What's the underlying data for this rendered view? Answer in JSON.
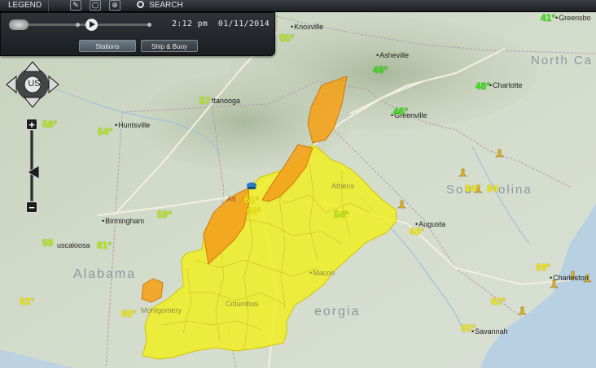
{
  "toolbar": {
    "legend_label": "LEGEND",
    "search_label": "SEARCH"
  },
  "time_panel": {
    "time": "2:12 pm",
    "date": "01/11/2014",
    "tabs": [
      {
        "label": "Stations",
        "active": true
      },
      {
        "label": "Ship & Buoy",
        "active": false
      }
    ]
  },
  "navigation": {
    "region_label": "US",
    "zoom_in": "+",
    "zoom_out": "−"
  },
  "states": [
    "North Ca",
    "Sou",
    "olina",
    "Alabama",
    "eorgia"
  ],
  "cities": [
    "Knoxville",
    "Asheville",
    "Greensbo",
    "Charlotte",
    "ttanooga",
    "Huntsville",
    "Greenville",
    "Athens",
    "Atl",
    "Birmingham",
    "Augusta",
    "uscaloosa",
    "Macon",
    "Montgomery",
    "Columbus",
    "Charleston",
    "Savannah"
  ],
  "temperatures": [
    {
      "value": "55°",
      "tone": "lime"
    },
    {
      "value": "41°",
      "tone": "green"
    },
    {
      "value": "49°",
      "tone": "green"
    },
    {
      "value": "48°",
      "tone": "green"
    },
    {
      "value": "57",
      "tone": "lime"
    },
    {
      "value": "56°",
      "tone": "lime"
    },
    {
      "value": "54°",
      "tone": "lime"
    },
    {
      "value": "46°",
      "tone": "green"
    },
    {
      "value": "61°",
      "tone": "yellow"
    },
    {
      "value": "63°",
      "tone": "yellow"
    },
    {
      "value": "54°",
      "tone": "lime"
    },
    {
      "value": "64°",
      "tone": "yellow"
    },
    {
      "value": "64",
      "tone": "yellow"
    },
    {
      "value": "59°",
      "tone": "lime"
    },
    {
      "value": "59",
      "tone": "lime"
    },
    {
      "value": "61°",
      "tone": "lime"
    },
    {
      "value": "66°",
      "tone": "yellow"
    },
    {
      "value": "62°",
      "tone": "yellow"
    },
    {
      "value": "66°",
      "tone": "yellow"
    },
    {
      "value": "68°",
      "tone": "yellow"
    },
    {
      "value": "62°",
      "tone": "yellow"
    },
    {
      "value": "65°",
      "tone": "yellow"
    }
  ],
  "colors": {
    "advisory_yellow": "#f1ef1c",
    "warning_orange": "#f3a21c",
    "land": "#cfd8c6",
    "water": "#b7d0e2",
    "temp_green": "#34e10f",
    "temp_yellow": "#f2f011"
  }
}
